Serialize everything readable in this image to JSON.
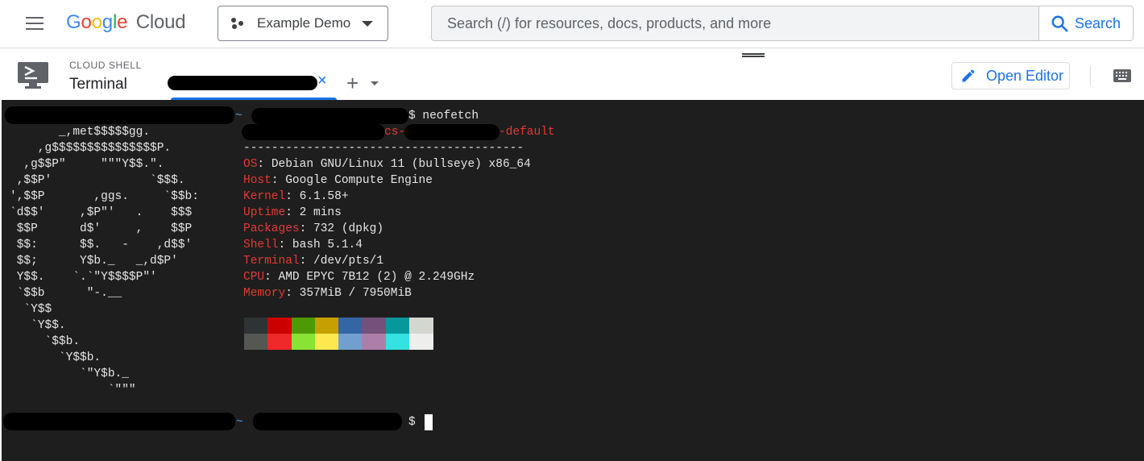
{
  "topbar": {
    "menu_icon": "hamburger-menu-icon",
    "logo_google": "Google",
    "logo_cloud": "Cloud",
    "project": "Example Demo",
    "search_placeholder": "Search (/) for resources, docs, products, and more",
    "search_label": "Search"
  },
  "shell": {
    "caption": "CLOUD SHELL",
    "title": "Terminal",
    "tab_close": "×",
    "tab_add": "+",
    "open_editor": "Open Editor"
  },
  "terminal": {
    "prompt1_tilde": "~",
    "prompt1_cmd": "$ neofetch",
    "host_suffix": "-default",
    "host_cs": "cs-",
    "separator": "----------------------------------------",
    "ascii": [
      "       _,met$$$$$gg.",
      "    ,g$$$$$$$$$$$$$$$P.",
      "  ,g$$P\"     \"\"\"Y$$.\".",
      " ,$$P'              `$$$.",
      "',$$P       ,ggs.     `$$b:",
      "`d$$'     ,$P\"'   .    $$$",
      " $$P      d$'     ,    $$P",
      " $$:      $$.   -    ,d$$'",
      " $$;      Y$b._   _,d$P'",
      " Y$$.    `.`\"Y$$$$P\"'",
      " `$$b      \"-.__",
      "  `Y$$",
      "   `Y$$.",
      "     `$$b.",
      "       `Y$$b.",
      "          `\"Y$b._",
      "              `\"\"\""
    ],
    "info": [
      {
        "key": "OS",
        "value": "Debian GNU/Linux 11 (bullseye) x86_64"
      },
      {
        "key": "Host",
        "value": "Google Compute Engine"
      },
      {
        "key": "Kernel",
        "value": "6.1.58+"
      },
      {
        "key": "Uptime",
        "value": "2 mins"
      },
      {
        "key": "Packages",
        "value": "732 (dpkg)"
      },
      {
        "key": "Shell",
        "value": "bash 5.1.4"
      },
      {
        "key": "Terminal",
        "value": "/dev/pts/1"
      },
      {
        "key": "CPU",
        "value": "AMD EPYC 7B12 (2) @ 2.249GHz"
      },
      {
        "key": "Memory",
        "value": "357MiB / 7950MiB"
      }
    ],
    "palette_top": [
      "#2e3436",
      "#cc0000",
      "#4e9a06",
      "#c4a000",
      "#3465a4",
      "#75507b",
      "#06989a",
      "#d3d7cf"
    ],
    "palette_bottom": [
      "#555753",
      "#ef2929",
      "#8ae234",
      "#fce94f",
      "#729fcf",
      "#ad7fa8",
      "#34e2e2",
      "#eeeeec"
    ],
    "prompt2_tilde": "~",
    "prompt2_end": "$"
  }
}
